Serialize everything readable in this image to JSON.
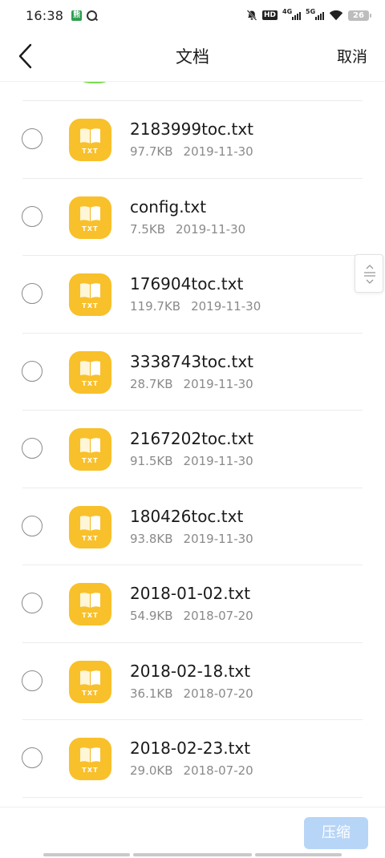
{
  "status_bar": {
    "time": "16:38",
    "app_badge": "熊",
    "network_4g": "4G",
    "network_5g": "5G",
    "hd_label": "HD",
    "battery": "26"
  },
  "header": {
    "title": "文档",
    "cancel_label": "取消"
  },
  "files": [
    {
      "name": "2183999toc.txt",
      "size": "97.7KB",
      "date": "2019-11-30",
      "ext": "TXT"
    },
    {
      "name": "config.txt",
      "size": "7.5KB",
      "date": "2019-11-30",
      "ext": "TXT"
    },
    {
      "name": "176904toc.txt",
      "size": "119.7KB",
      "date": "2019-11-30",
      "ext": "TXT"
    },
    {
      "name": "3338743toc.txt",
      "size": "28.7KB",
      "date": "2019-11-30",
      "ext": "TXT"
    },
    {
      "name": "2167202toc.txt",
      "size": "91.5KB",
      "date": "2019-11-30",
      "ext": "TXT"
    },
    {
      "name": "180426toc.txt",
      "size": "93.8KB",
      "date": "2019-11-30",
      "ext": "TXT"
    },
    {
      "name": "2018-01-02.txt",
      "size": "54.9KB",
      "date": "2018-07-20",
      "ext": "TXT"
    },
    {
      "name": "2018-02-18.txt",
      "size": "36.1KB",
      "date": "2018-07-20",
      "ext": "TXT"
    },
    {
      "name": "2018-02-23.txt",
      "size": "29.0KB",
      "date": "2018-07-20",
      "ext": "TXT"
    }
  ],
  "bottom_bar": {
    "compress_label": "压缩"
  },
  "colors": {
    "icon_yellow": "#f8c02a",
    "compress_disabled": "#b7d5f7",
    "meta_grey": "#8a8a8a"
  },
  "icons": {
    "back": "chevron-left-icon",
    "file": "txt-book-icon",
    "radio": "radio-unchecked-icon",
    "scroll": "fast-scroll-handle-icon"
  }
}
